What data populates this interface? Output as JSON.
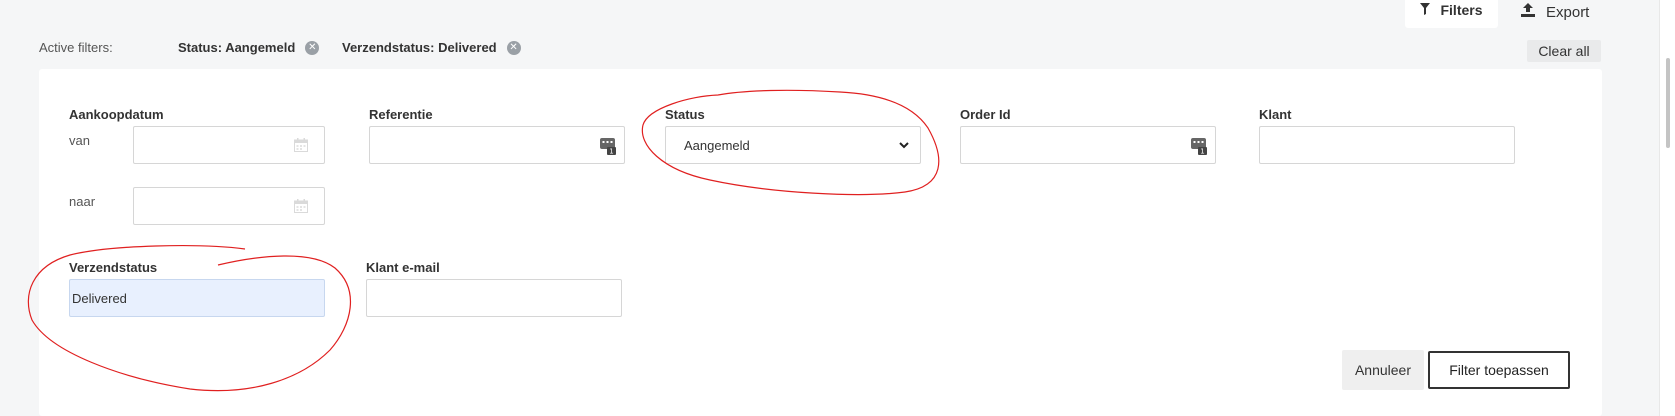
{
  "toolbar": {
    "filters_label": "Filters",
    "export_label": "Export"
  },
  "active_filters": {
    "label": "Active filters:",
    "chips": [
      {
        "label": "Status: Aangemeld"
      },
      {
        "label": "Verzendstatus: Delivered"
      }
    ],
    "clear_all_label": "Clear all"
  },
  "form": {
    "aankoopdatum": {
      "label": "Aankoopdatum",
      "from_label": "van",
      "to_label": "naar",
      "from_value": "",
      "to_value": ""
    },
    "referentie": {
      "label": "Referentie",
      "value": ""
    },
    "status": {
      "label": "Status",
      "selected": "Aangemeld"
    },
    "order_id": {
      "label": "Order Id",
      "value": ""
    },
    "klant": {
      "label": "Klant",
      "value": ""
    },
    "verzendstatus": {
      "label": "Verzendstatus",
      "value": "Delivered"
    },
    "klant_email": {
      "label": "Klant e-mail",
      "value": ""
    }
  },
  "actions": {
    "cancel_label": "Annuleer",
    "apply_label": "Filter toepassen"
  },
  "colors": {
    "annotation": "#e02020",
    "filled_field": "#e8f0fe",
    "panel": "#ffffff",
    "background": "#f5f6f7"
  }
}
